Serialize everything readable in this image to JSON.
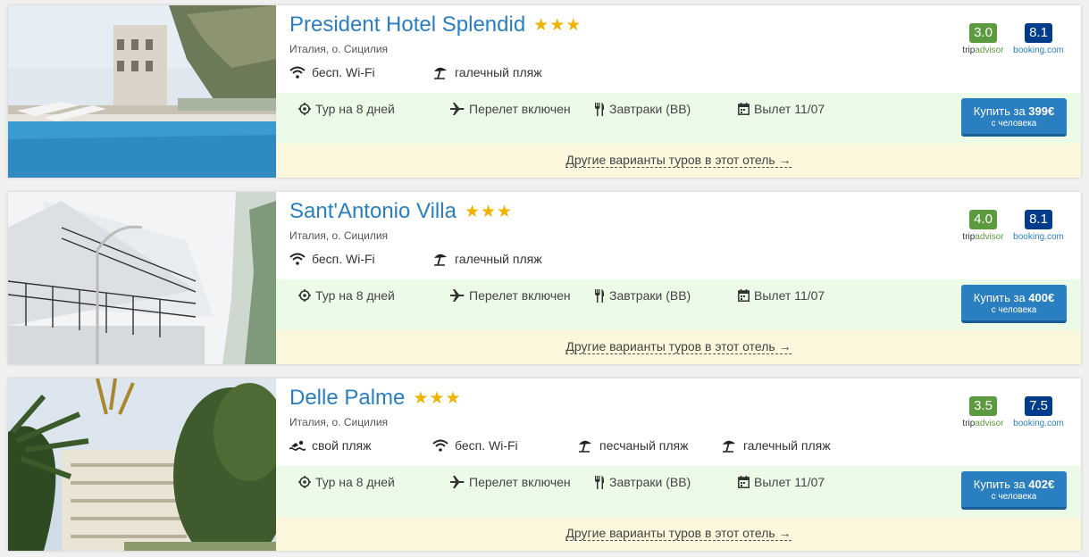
{
  "hotels": [
    {
      "name": "President Hotel Splendid",
      "stars": 3,
      "location": "Италия, о. Сицилия",
      "features": [
        {
          "icon": "wifi-icon",
          "label": "бесп. Wi-Fi"
        },
        {
          "icon": "beach-umbrella-icon",
          "label": "галечный пляж"
        }
      ],
      "tripadvisor": {
        "score": "3.0",
        "label_a": "trip",
        "label_b": "advisor"
      },
      "booking": {
        "score": "8.1",
        "label": "booking.com"
      },
      "tour": {
        "duration": "Тур на 8 дней",
        "flight": "Перелет включен",
        "meals": "Завтраки (BB)",
        "departure": "Вылет 11/07"
      },
      "buy": {
        "prefix": "Купить за ",
        "price": "399€",
        "per": "с человека"
      },
      "other_link": "Другие варианты туров в этот отель →"
    },
    {
      "name": "Sant'Antonio Villa",
      "stars": 3,
      "location": "Италия, о. Сицилия",
      "features": [
        {
          "icon": "wifi-icon",
          "label": "бесп. Wi-Fi"
        },
        {
          "icon": "beach-umbrella-icon",
          "label": "галечный пляж"
        }
      ],
      "tripadvisor": {
        "score": "4.0",
        "label_a": "trip",
        "label_b": "advisor"
      },
      "booking": {
        "score": "8.1",
        "label": "booking.com"
      },
      "tour": {
        "duration": "Тур на 8 дней",
        "flight": "Перелет включен",
        "meals": "Завтраки (BB)",
        "departure": "Вылет 11/07"
      },
      "buy": {
        "prefix": "Купить за ",
        "price": "400€",
        "per": "с человека"
      },
      "other_link": "Другие варианты туров в этот отель →"
    },
    {
      "name": "Delle Palme",
      "stars": 3,
      "location": "Италия, о. Сицилия",
      "features": [
        {
          "icon": "swimmer-icon",
          "label": "свой пляж"
        },
        {
          "icon": "wifi-icon",
          "label": "бесп. Wi-Fi"
        },
        {
          "icon": "beach-umbrella-icon",
          "label": "песчаный пляж"
        },
        {
          "icon": "beach-umbrella-icon",
          "label": "галечный пляж"
        }
      ],
      "tripadvisor": {
        "score": "3.5",
        "label_a": "trip",
        "label_b": "advisor"
      },
      "booking": {
        "score": "7.5",
        "label": "booking.com"
      },
      "tour": {
        "duration": "Тур на 8 дней",
        "flight": "Перелет включен",
        "meals": "Завтраки (BB)",
        "departure": "Вылет 11/07"
      },
      "buy": {
        "prefix": "Купить за ",
        "price": "402€",
        "per": "с человека"
      },
      "other_link": "Другие варианты туров в этот отель →"
    }
  ],
  "colors": {
    "link": "#2a7fc0",
    "star": "#f0b400",
    "tripadvisor": "#5c9a3f",
    "booking": "#003c8a",
    "green_band": "#ecfbe8",
    "yellow_band": "#fbf7dc"
  }
}
